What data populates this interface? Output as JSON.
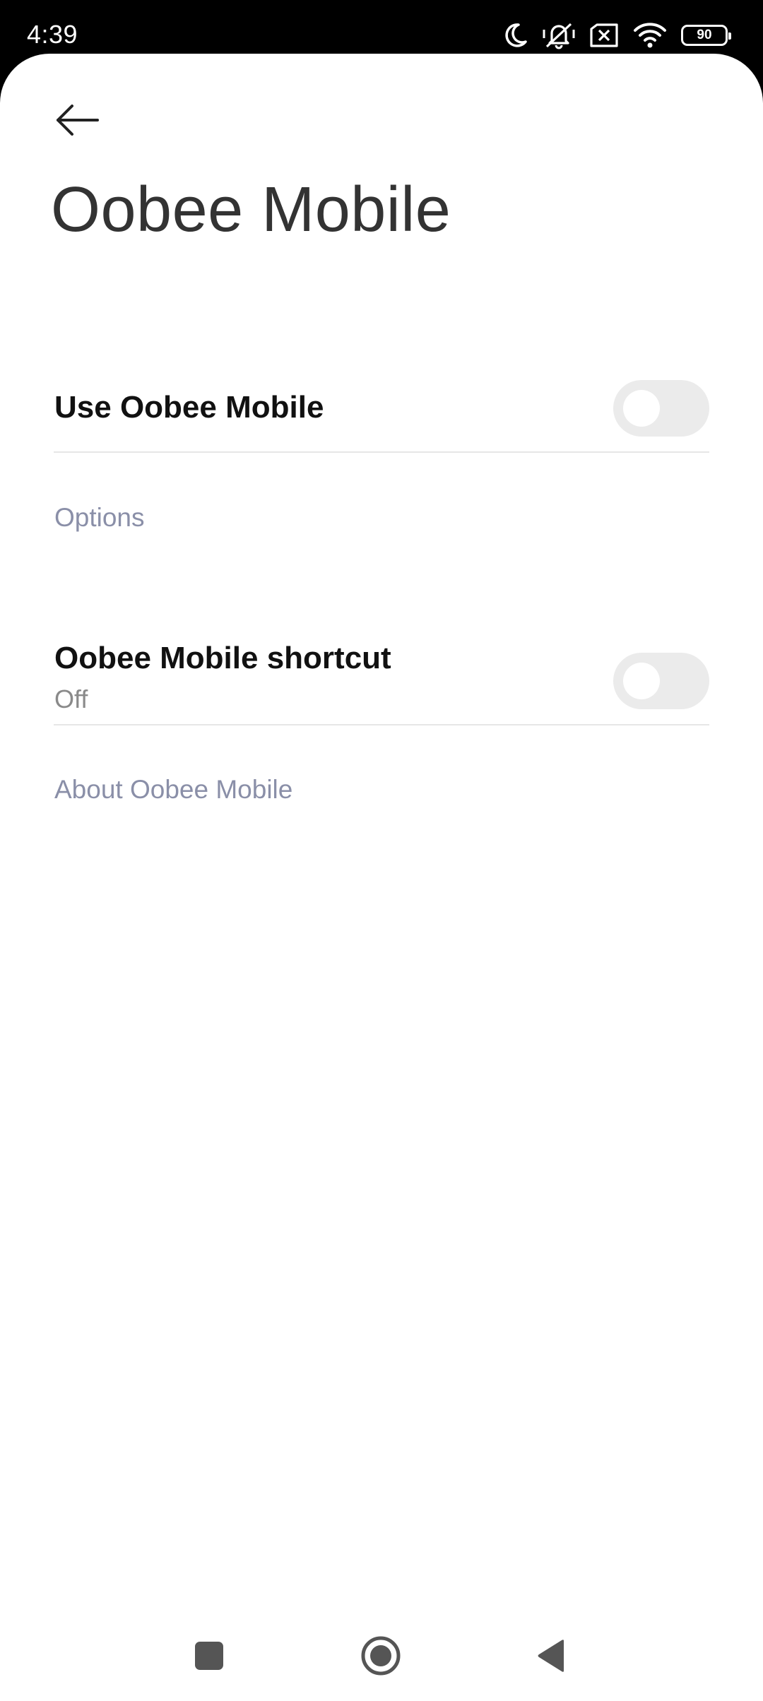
{
  "status_bar": {
    "time": "4:39",
    "battery_level": "90",
    "icons": [
      "moon-icon",
      "muted-bell-icon",
      "no-sim-icon",
      "wifi-icon",
      "battery-icon"
    ]
  },
  "header": {
    "back_icon": "back-arrow-icon",
    "title": "Oobee Mobile"
  },
  "main_toggle": {
    "label": "Use Oobee Mobile",
    "enabled": false
  },
  "options": {
    "header": "Options",
    "shortcut": {
      "label": "Oobee Mobile shortcut",
      "status": "Off",
      "enabled": false
    }
  },
  "about": {
    "header": "About Oobee Mobile"
  },
  "nav_bar": {
    "icons": [
      "recents-square-icon",
      "home-circle-icon",
      "back-triangle-icon"
    ]
  },
  "colors": {
    "status_bar_bg": "#000000",
    "sheet_bg": "#ffffff",
    "toggle_off": "#ebebeb",
    "section_header": "#8a8fa8"
  }
}
